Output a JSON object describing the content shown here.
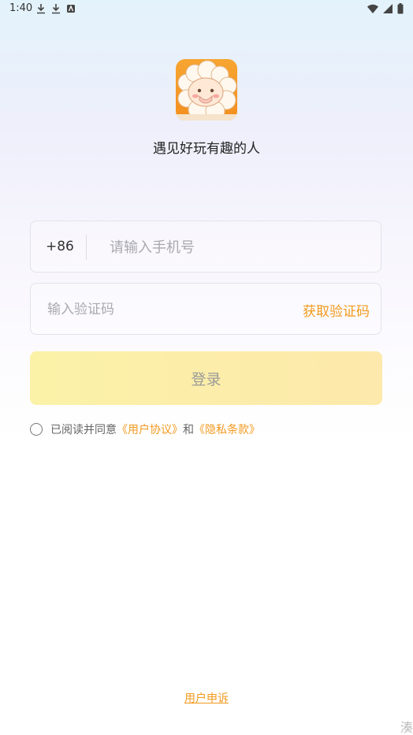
{
  "status_bar": {
    "time": "1:40",
    "left_icons": [
      "download-icon",
      "download-icon",
      "app-notification-icon"
    ],
    "right_icons": [
      "wifi-icon",
      "signal-icon",
      "battery-icon"
    ]
  },
  "app": {
    "logo_icon": "sheep-mascot-logo",
    "slogan": "遇见好玩有趣的人"
  },
  "phone_field": {
    "country_code": "+86",
    "placeholder": "请输入手机号",
    "value": ""
  },
  "code_field": {
    "placeholder": "输入验证码",
    "value": "",
    "get_code_label": "获取验证码"
  },
  "login_button": {
    "label": "登录"
  },
  "agreement": {
    "prefix": "已阅读并同意",
    "user_agreement": "《用户协议》",
    "conjunction": "和",
    "privacy_policy": "《隐私条款》",
    "checked": false
  },
  "footer": {
    "appeal_link": "用户申诉",
    "corner_text": "湊"
  },
  "colors": {
    "accent": "#f29a1e",
    "button_gradient_start": "#fbf2a8",
    "button_gradient_end": "#fde9ab"
  }
}
